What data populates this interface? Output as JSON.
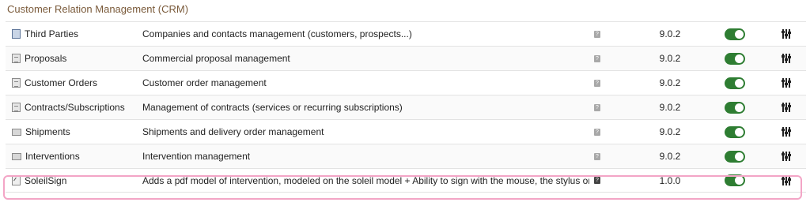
{
  "section": {
    "title": "Customer Relation Management (CRM)"
  },
  "colors": {
    "toggle_on": "#2e7d32",
    "highlight": "#f3a5c6",
    "section_title": "#7a5a3a"
  },
  "modules": [
    {
      "name": "Third Parties",
      "icon": "third-parties-icon",
      "description": "Companies and contacts management (customers, prospects...)",
      "version": "9.0.2",
      "enabled": true
    },
    {
      "name": "Proposals",
      "icon": "document-icon",
      "description": "Commercial proposal management",
      "version": "9.0.2",
      "enabled": true
    },
    {
      "name": "Customer Orders",
      "icon": "document-icon",
      "description": "Customer order management",
      "version": "9.0.2",
      "enabled": true
    },
    {
      "name": "Contracts/Subscriptions",
      "icon": "document-icon",
      "description": "Management of contracts (services or recurring subscriptions)",
      "version": "9.0.2",
      "enabled": true
    },
    {
      "name": "Shipments",
      "icon": "truck-icon",
      "description": "Shipments and delivery order management",
      "version": "9.0.2",
      "enabled": true
    },
    {
      "name": "Interventions",
      "icon": "truck-icon",
      "description": "Intervention management",
      "version": "9.0.2",
      "enabled": true
    },
    {
      "name": "SoleilSign",
      "icon": "signature-icon",
      "description": "Adds a pdf model of intervention, modeled on the soleil model + Ability to sign with the mouse, the stylus or e...",
      "version": "1.0.0",
      "enabled": true
    }
  ]
}
